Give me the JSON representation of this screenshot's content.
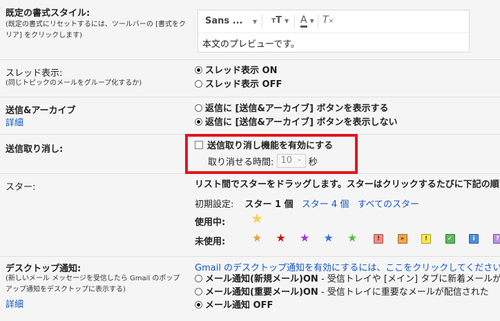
{
  "default_style": {
    "label": "既定の書式スタイル:",
    "help": "(既定の書式にリセットするには、ツールバーの [書式をクリア] をクリックします)",
    "font_select": "Sans ...",
    "preview_text": "本文のプレビューです。",
    "toolbar_icons": [
      "font-size-icon",
      "text-color-icon",
      "clear-format-icon"
    ]
  },
  "threading": {
    "label": "スレッド表示:",
    "help": "(同じトピックのメールをグループ化するか)",
    "on_label": "スレッド表示 ON",
    "off_label": "スレッド表示 OFF",
    "selected": "on"
  },
  "send_archive": {
    "label": "送信&アーカイブ",
    "details_link": "詳細",
    "show_label": "返信に [送信&アーカイブ] ボタンを表示する",
    "hide_label": "返信に [送信&アーカイブ] ボタンを表示しない",
    "selected": "hide"
  },
  "undo_send": {
    "label": "送信取り消し:",
    "enable_label": "送信取り消し機能を有効にする",
    "period_label": "取り消せる時間:",
    "period_value": "10",
    "period_unit": "秒",
    "highlight_color": "#e0151e"
  },
  "stars": {
    "label": "スター:",
    "description": "リスト間でスターをドラッグします。スターはクリックするたびに下記の順で切",
    "presets_label": "初期設定:",
    "preset_current": "スター 1 個",
    "preset_4": "スター 4 個",
    "preset_all": "すべてのスター",
    "in_use_label": "使用中:",
    "not_in_use_label": "未使用:",
    "in_use": [
      {
        "name": "yellow-star-icon",
        "color": "#f4c20d",
        "glyph": "★"
      }
    ],
    "not_in_use_stars": [
      {
        "name": "orange-star-icon",
        "color": "#f29b3a"
      },
      {
        "name": "red-star-icon",
        "color": "#d01010"
      },
      {
        "name": "purple-star-icon",
        "color": "#a334d6"
      },
      {
        "name": "blue-star-icon",
        "color": "#3b75d8"
      },
      {
        "name": "green-star-icon",
        "color": "#57b948"
      }
    ],
    "not_in_use_badges": [
      {
        "name": "red-bang-icon",
        "glyph": "!",
        "bg": "#f28b82",
        "fg": "#7a1a14"
      },
      {
        "name": "orange-guillemet-icon",
        "glyph": "»",
        "bg": "#f6a34f",
        "fg": "#5a2a00"
      },
      {
        "name": "yellow-bang-icon",
        "glyph": "!",
        "bg": "#fce84a",
        "fg": "#5a4a00"
      },
      {
        "name": "green-check-icon",
        "glyph": "✓",
        "bg": "#5cb85c",
        "fg": "#ffffff"
      },
      {
        "name": "blue-info-icon",
        "glyph": "i",
        "bg": "#4a90e2",
        "fg": "#ffffff"
      },
      {
        "name": "purple-question-icon",
        "glyph": "?",
        "bg": "#b98ee3",
        "fg": "#ffffff"
      }
    ]
  },
  "desktop": {
    "label": "デスクトップ通知:",
    "help": "(新しいメール メッセージを受信したら Gmail のポップアップ通知をデスクトップに表示する)",
    "details_link": "詳細",
    "enable_link": "Gmail のデスクトップ通知を有効にするには、ここをクリックしてください。",
    "new_on_bold": "メール通知(新規メール)ON",
    "new_on_rest": " - 受信トレイや [メイン] タブに新着メールが",
    "important_bold": "メール通知(重要メール)ON",
    "important_rest": " - 受信トレイに重要なメールが配信された",
    "off_bold": "メール通知 OFF",
    "selected": "off"
  }
}
